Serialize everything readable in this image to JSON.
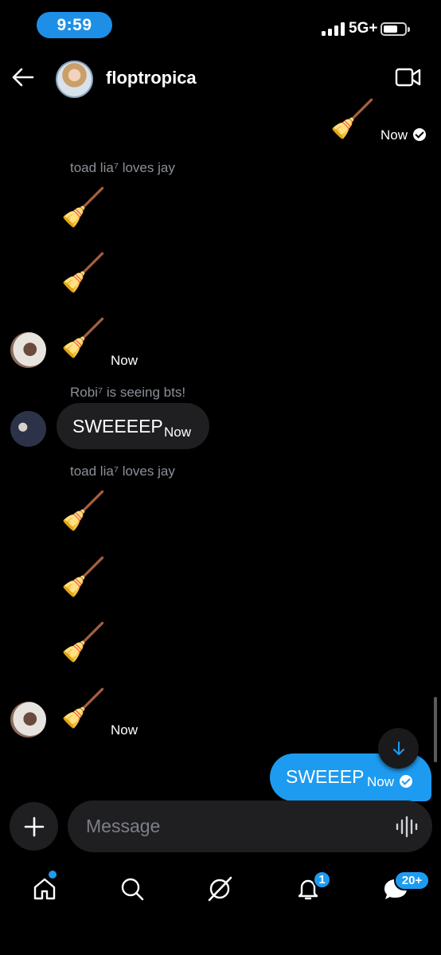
{
  "status_bar": {
    "time": "9:59",
    "network": "5G+"
  },
  "header": {
    "title": "floptropica"
  },
  "messages": {
    "broom": "🧹",
    "time_now": "Now",
    "sender_1": "toad lia⁷ loves jay",
    "sender_2": "Robi⁷ is seeing bts!",
    "sender_3": "toad lia⁷ loves jay",
    "incoming_text": "SWEEEEP",
    "outgoing_text": "SWEEEP"
  },
  "composer": {
    "placeholder": "Message"
  },
  "nav": {
    "notifications_count": "1",
    "messages_count": "20+"
  },
  "colors": {
    "accent": "#1d9bf0",
    "time_pill": "#1d8fe6",
    "bubble_in": "#1f1f21",
    "background": "#000000"
  }
}
